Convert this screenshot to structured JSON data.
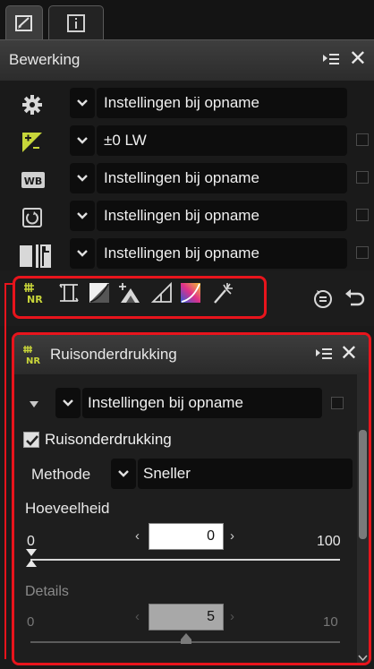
{
  "tabs": [
    {
      "icon": "edit-palette-icon",
      "active": true
    },
    {
      "icon": "info-icon",
      "active": false
    }
  ],
  "palette": {
    "title": "Bewerking",
    "menu_icon": "palette-menu-icon",
    "close_label": "✕"
  },
  "rows": [
    {
      "icon": "gear-icon",
      "value": "Instellingen bij opname"
    },
    {
      "icon": "exposure-compensation-icon",
      "value": "±0 LW"
    },
    {
      "icon": "white-balance-icon",
      "value": "Instellingen bij opname"
    },
    {
      "icon": "picture-control-icon",
      "value": "Instellingen bij opname"
    },
    {
      "icon": "active-d-lighting-icon",
      "value": "Instellingen bij opname"
    }
  ],
  "toolbar": {
    "tools": [
      "noise-reduction-tool-icon",
      "straighten-tool-icon",
      "levels-tool-icon",
      "lch-tool-icon",
      "perspective-tool-icon",
      "color-booster-tool-icon",
      "retouch-brush-tool-icon"
    ],
    "right": [
      "history-icon",
      "undo-icon"
    ]
  },
  "noise_reduction": {
    "title": "Ruisonderdrukking",
    "preset": "Instellingen bij opname",
    "enabled_label": "Ruisonderdrukking",
    "enabled": true,
    "method_label": "Methode",
    "method_value": "Sneller",
    "amount_label": "Hoeveelheid",
    "amount_min": "0",
    "amount_max": "100",
    "amount_value": "0",
    "details_label": "Details",
    "details_min": "0",
    "details_max": "10",
    "details_value": "5",
    "dec_glyph": "‹",
    "inc_glyph": "›"
  },
  "colors": {
    "highlight": "#e8141c",
    "panel_bg": "#1a1a1a",
    "field_bg": "#0d0d0d"
  }
}
